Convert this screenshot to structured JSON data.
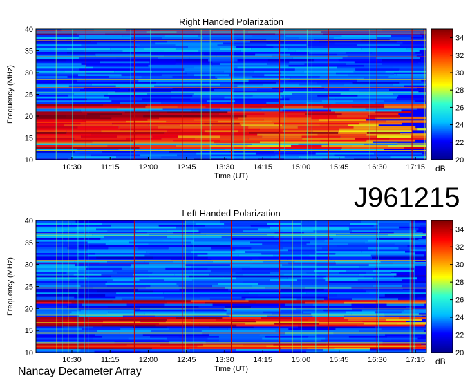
{
  "observation_id": "J961215",
  "instrument_credit": "Nancay Decameter Array",
  "colorbar_unit": "dB",
  "colormap": [
    "#00008f",
    "#0000ff",
    "#00bfff",
    "#30ffd0",
    "#ffff00",
    "#ff8000",
    "#ff0000",
    "#800000"
  ],
  "chart_data": [
    {
      "type": "heatmap",
      "title": "Right Handed Polarization",
      "xlabel": "Time (UT)",
      "ylabel": "Frequency (MHz)",
      "x_tick_labels": [
        "10:30",
        "11:15",
        "12:00",
        "12:45",
        "13:30",
        "14:15",
        "15:00",
        "15:45",
        "16:30",
        "17:15"
      ],
      "y_tick_labels": [
        "10",
        "15",
        "20",
        "25",
        "30",
        "35",
        "40"
      ],
      "ylim": [
        10,
        40
      ],
      "colorbar": {
        "label": "dB",
        "range": [
          20,
          35
        ],
        "ticks": [
          "20",
          "22",
          "24",
          "26",
          "28",
          "30",
          "32",
          "34"
        ]
      },
      "strong_bands_mhz": [
        [
          14,
          21
        ],
        [
          22,
          23
        ],
        [
          12.5,
          13.5
        ]
      ],
      "vertical_markers_color": "#c00000"
    },
    {
      "type": "heatmap",
      "title": "Left Handed Polarization",
      "xlabel": "Time (UT)",
      "ylabel": "Frequency (MHz)",
      "x_tick_labels": [
        "10:30",
        "11:15",
        "12:00",
        "12:45",
        "13:30",
        "14:15",
        "15:00",
        "15:45",
        "16:30",
        "17:15"
      ],
      "y_tick_labels": [
        "10",
        "15",
        "20",
        "25",
        "30",
        "35",
        "40"
      ],
      "ylim": [
        10,
        40
      ],
      "colorbar": {
        "label": "dB",
        "range": [
          20,
          35
        ],
        "ticks": [
          "20",
          "22",
          "24",
          "26",
          "28",
          "30",
          "32",
          "34"
        ]
      },
      "strong_bands_mhz": [
        [
          16,
          18
        ],
        [
          11,
          12
        ],
        [
          21,
          22
        ]
      ],
      "vertical_markers_color": "#c00000"
    }
  ]
}
